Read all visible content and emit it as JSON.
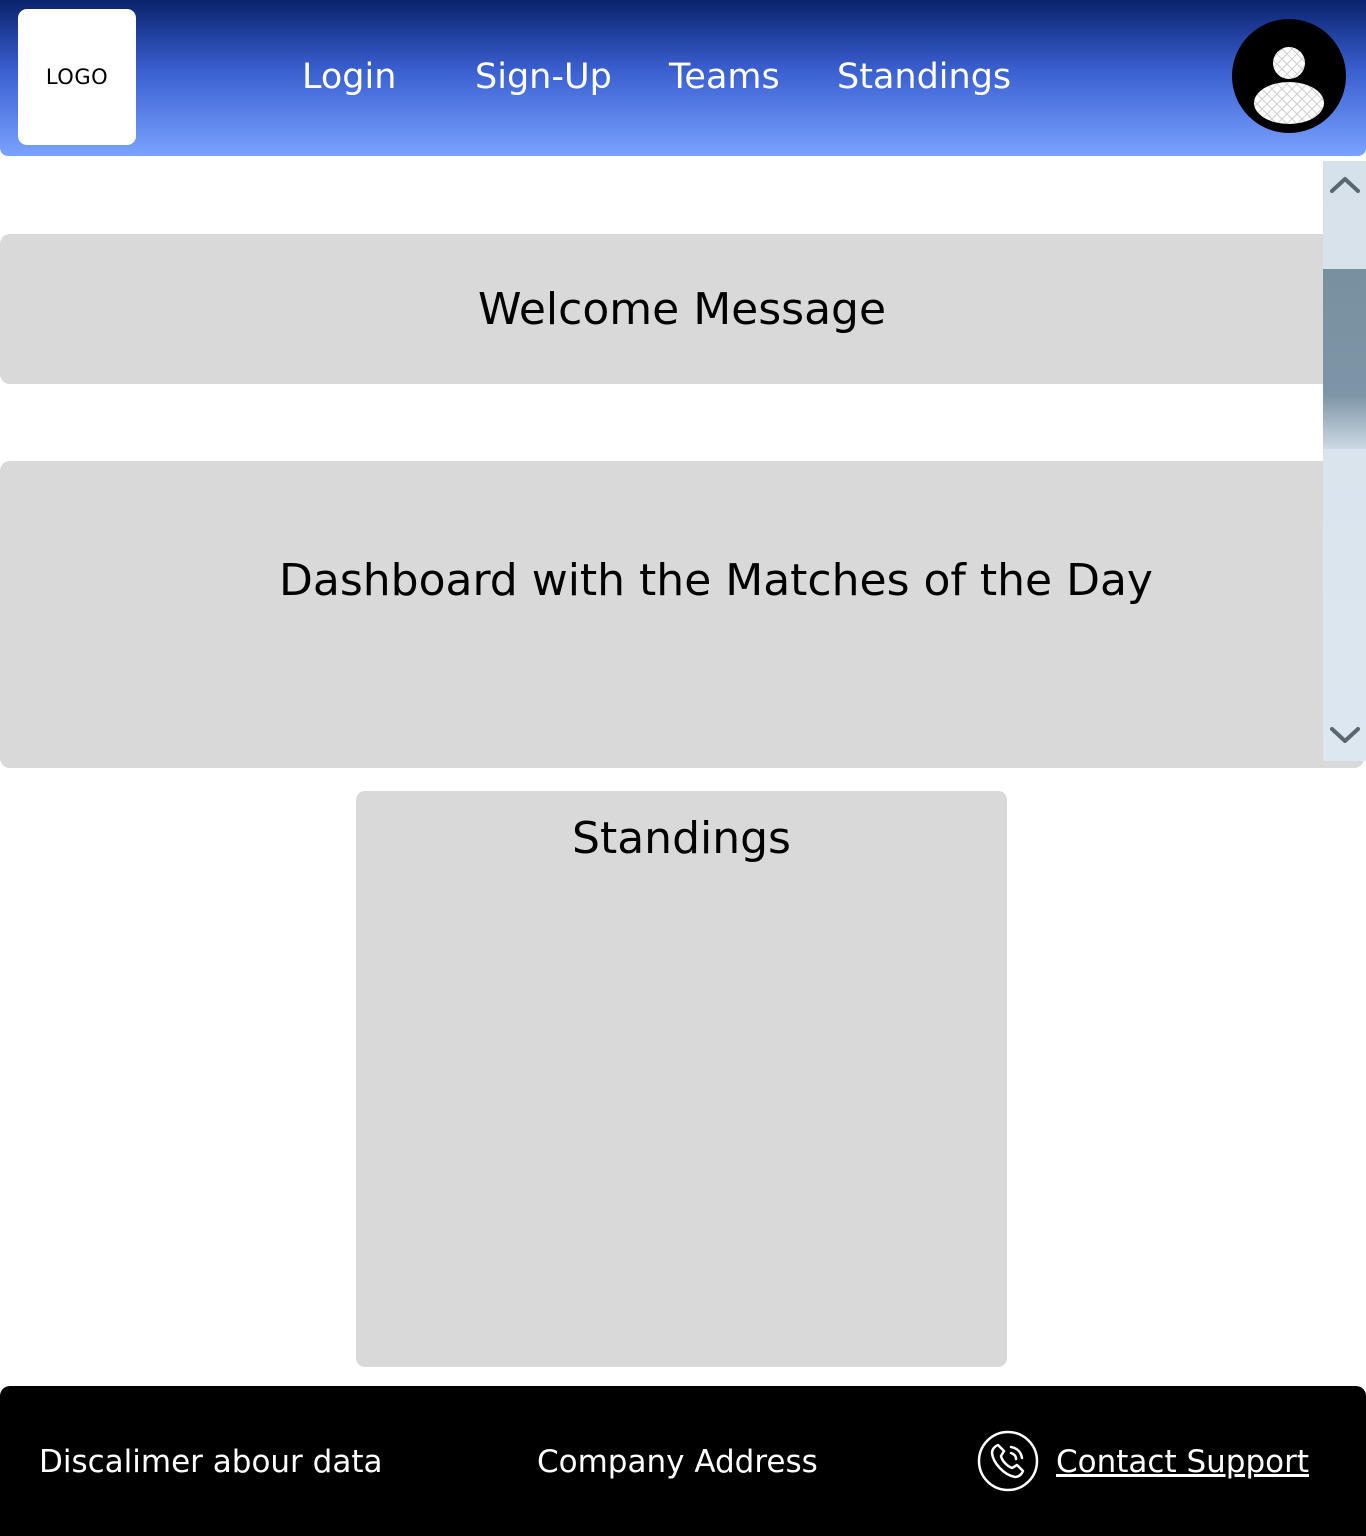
{
  "header": {
    "logo_text": "LOGO",
    "nav": [
      {
        "label": "Login"
      },
      {
        "label": "Sign-Up"
      },
      {
        "label": "Teams"
      },
      {
        "label": "Standings"
      }
    ],
    "avatar_icon": "user-avatar-icon"
  },
  "main": {
    "welcome": "Welcome Message",
    "dashboard": "Dashboard with the Matches of the Day",
    "standings_title": "Standings"
  },
  "scrollbar": {
    "up_icon": "chevron-up-icon",
    "down_icon": "chevron-down-icon"
  },
  "footer": {
    "disclaimer": "Discalimer  abour data",
    "address": "Company Address",
    "contact_label": "Contact Support",
    "contact_icon": "phone-icon"
  },
  "colors": {
    "header_top": "#0a236e",
    "header_bottom": "#7aa2ff",
    "panel": "#d9d9d9",
    "footer": "#000000"
  }
}
